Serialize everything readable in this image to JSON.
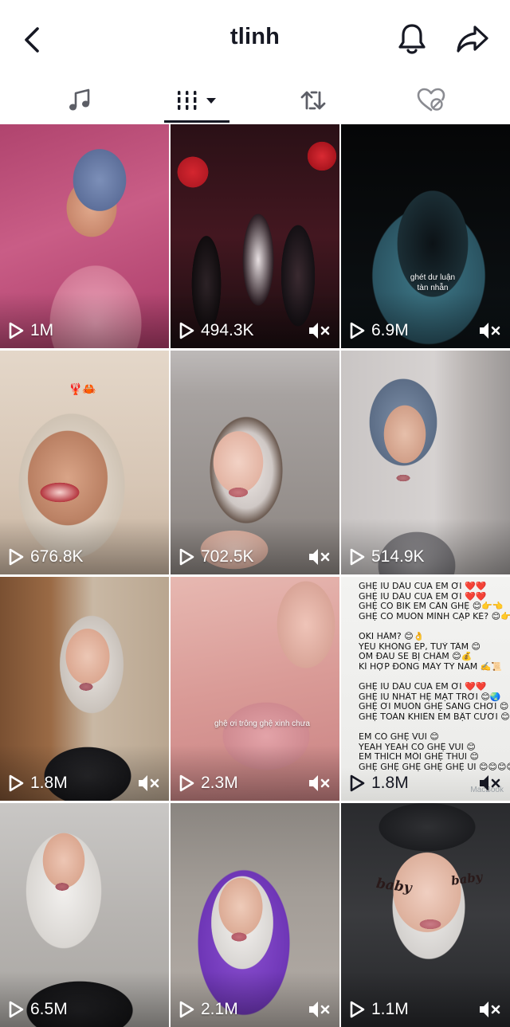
{
  "header": {
    "title": "tlinh",
    "back_icon": "chevron-left-icon",
    "notify_icon": "bell-icon",
    "share_icon": "share-arrow-icon"
  },
  "tabs": [
    {
      "name": "music",
      "icon": "music-note-icon"
    },
    {
      "name": "videos",
      "icon": "grid-filter-icon",
      "selected": true
    },
    {
      "name": "reposts",
      "icon": "repost-icon"
    },
    {
      "name": "liked",
      "icon": "liked-hidden-icon"
    }
  ],
  "videos": [
    {
      "views": "1M",
      "muted": false
    },
    {
      "views": "494.3K",
      "muted": true
    },
    {
      "views": "6.9M",
      "muted": true,
      "caption": "ghét dư luận\ntàn nhẫn"
    },
    {
      "views": "676.8K",
      "muted": false,
      "sticker": "🦞🦀"
    },
    {
      "views": "702.5K",
      "muted": true
    },
    {
      "views": "514.9K",
      "muted": false
    },
    {
      "views": "1.8M",
      "muted": true
    },
    {
      "views": "2.3M",
      "muted": true,
      "caption": "ghệ ơi trông ghệ xinh chưa"
    },
    {
      "views": "1.8M",
      "muted": true,
      "note_lines": [
        "GHỆ IU DẤU CỦA EM ƠI ❤️❤️",
        "GHỆ IU DẤU CỦA EM ƠI ❤️❤️",
        "GHỆ CÓ BIK EM CẦN GHỆ 😊👉👈",
        "GHỆ CÓ MUỐN MÌNH CẶP KÈ? 😊👉👈",
        "",
        "OKI HÂM? 😊👌",
        "YÊU KHÔNG ÉP, TUỲ TÂM 😊",
        "ÔM ĐAU SẼ BỊ CHẦM 😊💰",
        "KÍ HỢP ĐỒNG MẤY TỶ NĂM ✍️📜",
        "",
        "GHỆ IU DẤU CỦA EM ƠI ❤️❤️",
        "GHỆ IU NHẤT HỆ MẶT TRỜI 😊🌏",
        "GHỆ ƠI MUỐN GHỆ SANG CHƠI 😊",
        "GHỆ TOÀN KHIẾN EM BẬT CƯỜI 😊",
        "",
        "EM CÓ GHỆ VUI 😊",
        "YEAH YEAH CÓ GHỆ VUI 😊",
        "EM THÍCH MỖI GHỆ THUI 😊",
        "GHỆ GHỆ GHỆ GHỆ GHỆ UI 😊😊😊😊"
      ],
      "device_label": "MacBook"
    },
    {
      "views": "6.5M",
      "muted": false
    },
    {
      "views": "2.1M",
      "muted": true
    },
    {
      "views": "1.1M",
      "muted": true,
      "face_text_left": "baby",
      "face_text_right": "baby"
    }
  ],
  "colors": {
    "text": "#161823",
    "overlay_text": "#ffffff",
    "tab_underline": "#161823"
  }
}
